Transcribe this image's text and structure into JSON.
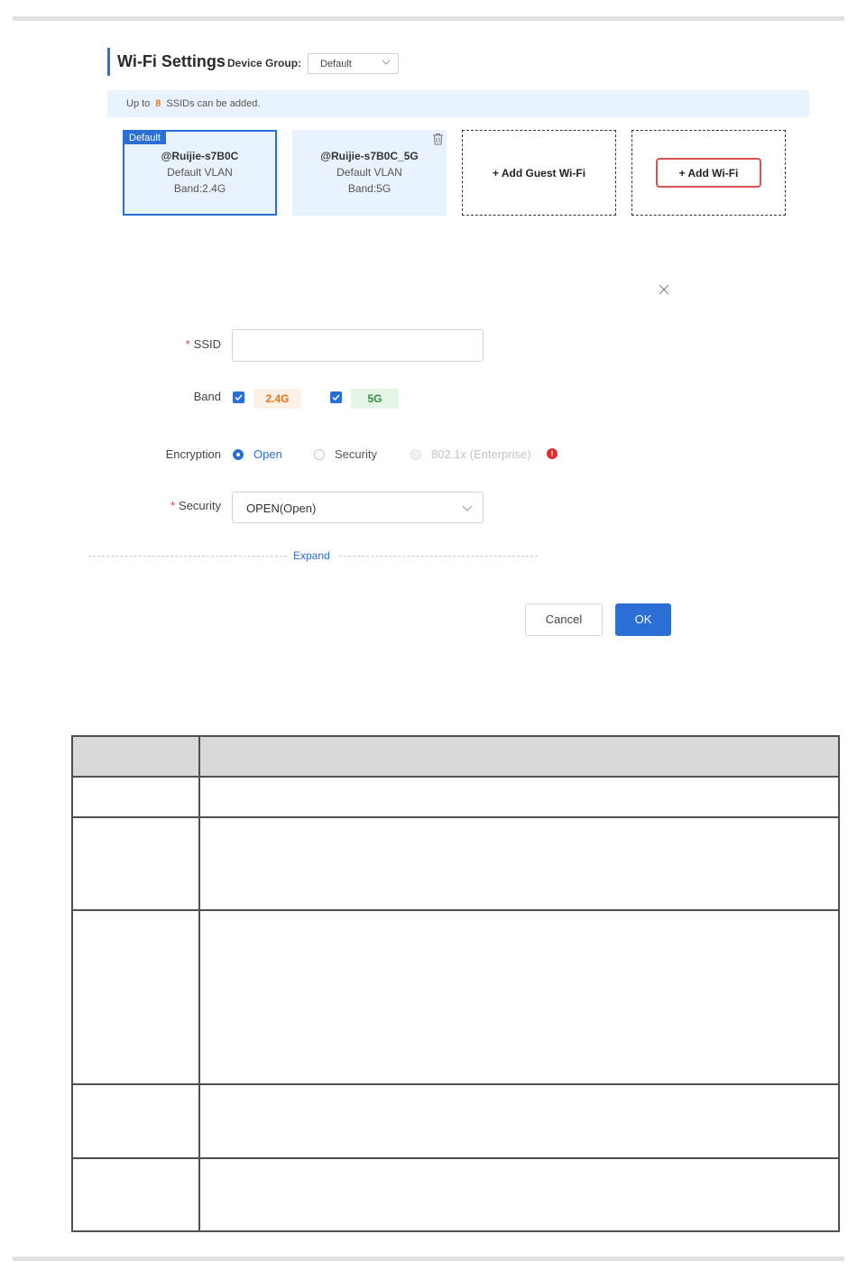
{
  "header": {
    "title": "Wi-Fi Settings",
    "device_group_label": "Device Group:",
    "device_group_value": "Default"
  },
  "notice": {
    "prefix": "Up to",
    "count": "8",
    "suffix": "SSIDs can be added."
  },
  "cards": [
    {
      "tag": "Default",
      "ssid": "@Ruijie-s7B0C",
      "vlan": "Default VLAN",
      "band": "Band:2.4G"
    },
    {
      "ssid": "@Ruijie-s7B0C_5G",
      "vlan": "Default VLAN",
      "band": "Band:5G"
    }
  ],
  "add_guest_label": "+ Add Guest Wi-Fi",
  "add_wifi_label": "+ Add Wi-Fi",
  "form": {
    "ssid_label": "SSID",
    "ssid_value": "",
    "band_label": "Band",
    "band_24": "2.4G",
    "band_5": "5G",
    "encryption_label": "Encryption",
    "enc_open": "Open",
    "enc_security": "Security",
    "enc_enterprise": "802.1x (Enterprise)",
    "security_label": "Security",
    "security_value": "OPEN(Open)",
    "expand_label": "Expand",
    "cancel_label": "Cancel",
    "ok_label": "OK",
    "required_mark": "*"
  },
  "colors": {
    "accent": "#2b6fd6",
    "highlight_border": "#d9534f",
    "band24": "#e8741d",
    "band5": "#2f8f3a"
  },
  "table": {
    "header": [
      "",
      ""
    ],
    "rows": [
      [
        "",
        ""
      ],
      [
        "",
        ""
      ],
      [
        "",
        ""
      ],
      [
        "",
        ""
      ],
      [
        "",
        ""
      ]
    ]
  }
}
